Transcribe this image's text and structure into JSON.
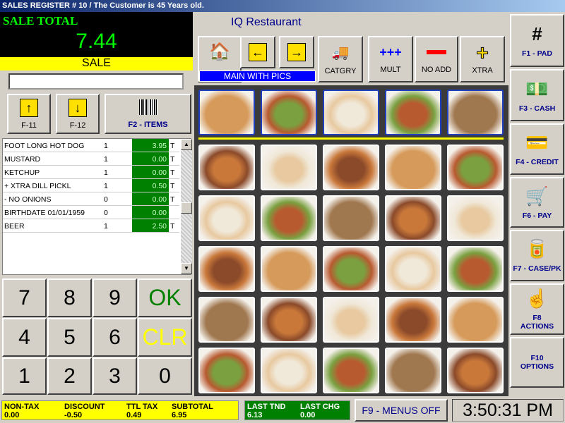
{
  "title": "SALES REGISTER # 10  / The Customer is 45 Years old.",
  "sale": {
    "label": "SALE TOTAL",
    "amount": "7.44",
    "mode": "SALE",
    "input_value": ""
  },
  "nav": {
    "up_label": "F-11",
    "down_label": "F-12",
    "items_label": "F2 - ITEMS"
  },
  "items": [
    {
      "desc": "FOOT LONG HOT DOG",
      "qty": "1",
      "price": "3.95",
      "tax": "T"
    },
    {
      "desc": " MUSTARD",
      "qty": "1",
      "price": "0.00",
      "tax": "T"
    },
    {
      "desc": " KETCHUP",
      "qty": "1",
      "price": "0.00",
      "tax": "T"
    },
    {
      "desc": " + XTRA  DILL PICKL",
      "qty": "1",
      "price": "0.50",
      "tax": "T"
    },
    {
      "desc": " - NO  ONIONS",
      "qty": "0",
      "price": "0.00",
      "tax": "T"
    },
    {
      "desc": "BIRTHDATE 01/01/1959",
      "qty": "0",
      "price": "0.00",
      "tax": ""
    },
    {
      "desc": "BEER",
      "qty": "1",
      "price": "2.50",
      "tax": "T"
    }
  ],
  "keypad": [
    "7",
    "8",
    "9",
    "OK",
    "4",
    "5",
    "6",
    "CLR",
    "1",
    "2",
    "3",
    "0"
  ],
  "colors": {
    "ok": "#008000",
    "clr": "#ffff00",
    "total": "#00ff00",
    "price_bg": "#008000"
  },
  "center": {
    "title": "IQ Restaurant",
    "menu_label": "MAIN WITH PICS",
    "toolbar": {
      "category": "CATGRY",
      "mult": "MULT",
      "mult_icon": "+++",
      "no_add": "NO ADD",
      "xtra": "XTRA"
    }
  },
  "categories": [
    "utensils",
    "ice-cream",
    "wine",
    "sandwich",
    "drinks"
  ],
  "menu_items": [
    "hot-dog",
    "corn-dog",
    "chili-dog",
    "sub-dog",
    "tomato-dog",
    "grilled-dog",
    "fries",
    "salad",
    "egg-rolls",
    "salad-plate",
    "shrimp",
    "tacos",
    "chicken-salad",
    "noodle-salad",
    "tossed-salad",
    "steak",
    "cheesecake",
    "chocolate-cake",
    "sundae",
    "parfait",
    "ice-cream",
    "beer",
    "cocktails",
    "cocktail-glasses",
    "wine-glasses"
  ],
  "right": [
    {
      "icon": "#",
      "label": "F1 - PAD"
    },
    {
      "icon": "💵",
      "label": "F3 - CASH"
    },
    {
      "icon": "💳",
      "label": "F4 - CREDIT"
    },
    {
      "icon": "🛒",
      "label": "F6 - PAY"
    },
    {
      "icon": "🥫",
      "label": "F7 - CASE/PK"
    },
    {
      "icon": "☝",
      "label": "F8\nACTIONS"
    },
    {
      "icon": "",
      "label": "F10\nOPTIONS"
    }
  ],
  "status": {
    "nontax_label": "NON-TAX",
    "nontax": "0.00",
    "discount_label": "DISCOUNT",
    "discount": "-0.50",
    "tax_label": "TTL TAX",
    "tax": "0.49",
    "subtotal_label": "SUBTOTAL",
    "subtotal": "6.95",
    "tnd_label": "LAST TND",
    "tnd": "6.13",
    "chg_label": "LAST CHG",
    "chg": "0.00",
    "menus_label": "F9 - MENUS OFF",
    "clock": "3:50:31 PM"
  }
}
